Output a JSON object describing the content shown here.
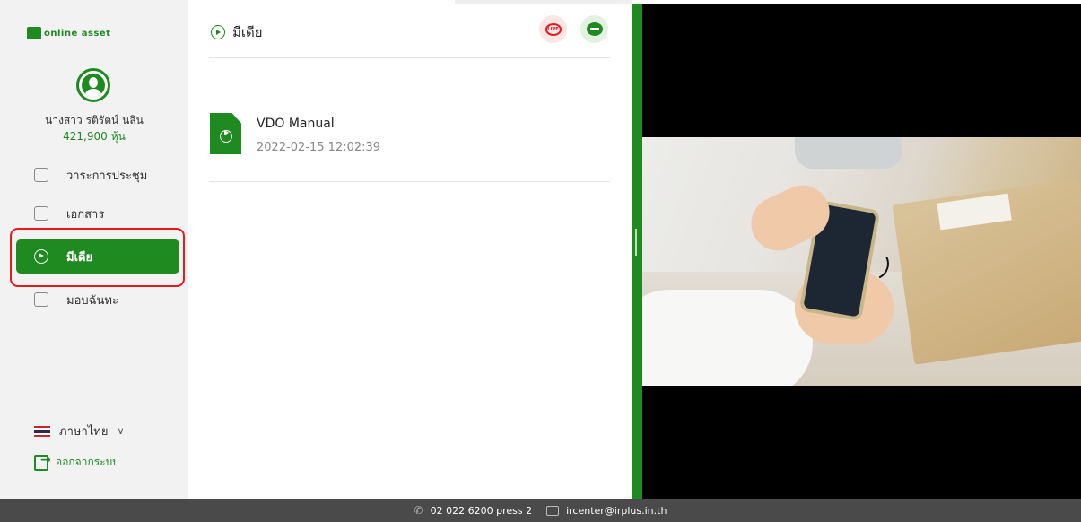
{
  "sidebar": {
    "logo_text": "online asset",
    "user_name": "นางสาว รติรัตน์ นลิน",
    "shares_value": "421,900",
    "shares_unit": "หุ้น",
    "nav": [
      {
        "label": "วาระการประชุม",
        "icon": "agenda-icon"
      },
      {
        "label": "เอกสาร",
        "icon": "document-icon"
      },
      {
        "label": "มีเดีย",
        "icon": "media-play-icon",
        "active": true
      },
      {
        "label": "มอบฉันทะ",
        "icon": "proxy-icon"
      }
    ],
    "language": "ภาษาไทย",
    "logout": "ออกจากระบบ"
  },
  "main": {
    "title": "มีเดีย",
    "live_badge": "LIVE",
    "files": [
      {
        "name": "VDO Manual",
        "date": "2022-02-15 12:02:39"
      }
    ]
  },
  "footer": {
    "phone": "02 022 6200 press 2",
    "email": "ircenter@irplus.in.th"
  },
  "colors": {
    "accent": "#1f8a1f",
    "highlight": "#e31b1b",
    "footer_bg": "#4a4a4a"
  }
}
